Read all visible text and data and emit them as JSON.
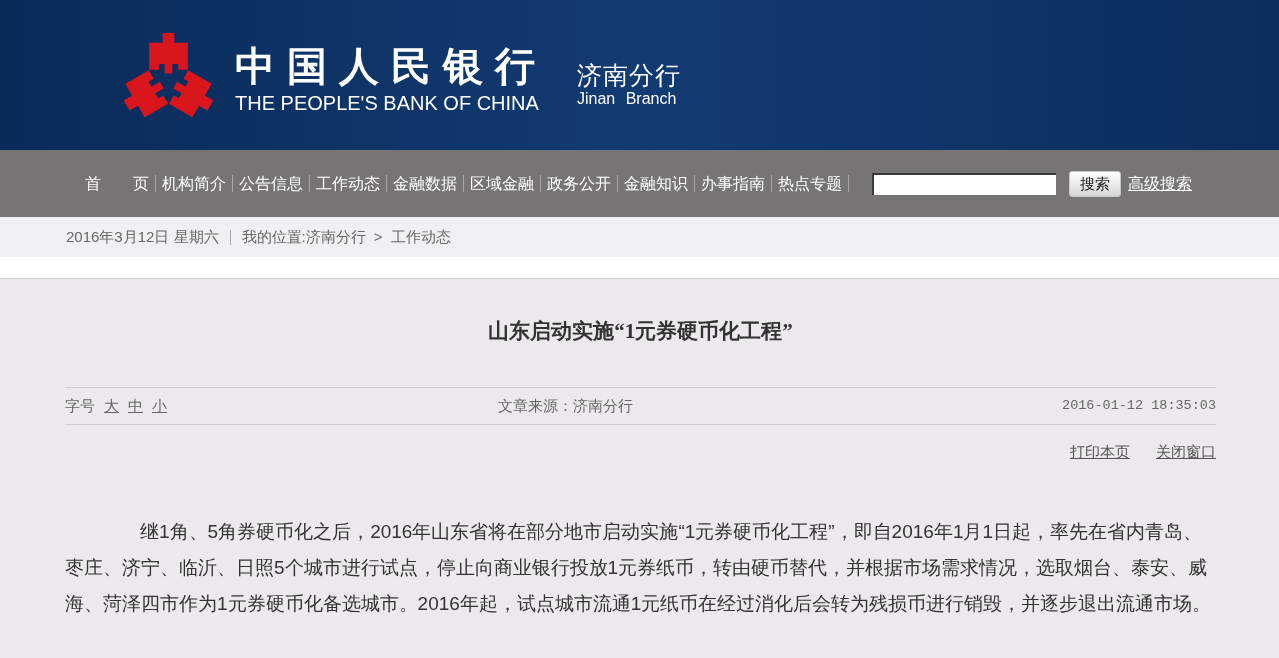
{
  "header": {
    "title_cn": "中国人民银行",
    "title_en": "THE PEOPLE'S BANK OF CHINA",
    "branch_cn": "济南分行",
    "branch_en": "Jinan Branch"
  },
  "nav": {
    "items": [
      "首　　页",
      "机构简介",
      "公告信息",
      "工作动态",
      "金融数据",
      "区域金融",
      "政务公开",
      "金融知识",
      "办事指南",
      "热点专题"
    ],
    "search_button": "搜索",
    "advanced_search": "高级搜索"
  },
  "info_bar": {
    "date": "2016年3月12日 星期六",
    "location_label": "我的位置:",
    "breadcrumb": [
      "济南分行",
      "工作动态"
    ],
    "breadcrumb_separator": ">"
  },
  "article": {
    "title": "山东启动实施“1元券硬币化工程”",
    "font_size_label": "字号",
    "font_sizes": [
      "大",
      "中",
      "小"
    ],
    "source": "文章来源：济南分行",
    "datetime": "2016-01-12 18:35:03",
    "actions": [
      "打印本页",
      "关闭窗口"
    ],
    "body": [
      "继1角、5角券硬币化之后，2016年山东省将在部分地市启动实施“1元券硬币化工程”，即自2016年1月1日起，率先在省内青岛、枣庄、济宁、临沂、日照5个城市进行试点，停止向商业银行投放1元券纸币，转由硬币替代，并根据市场需求情况，选取烟台、泰安、威海、菏泽四市作为1元券硬币化备选城市。2016年起，试点城市流通1元纸币在经过消化后会转为残损币进行销毁，并逐步退出流通市场。"
    ]
  }
}
